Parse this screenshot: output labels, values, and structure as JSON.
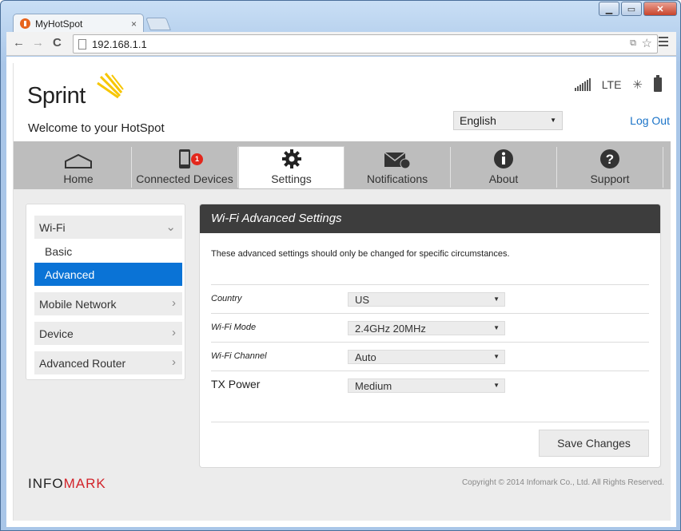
{
  "browser": {
    "tab_title": "MyHotSpot",
    "tab_close": "×",
    "url": "192.168.1.1",
    "back": "←",
    "forward": "→",
    "reload": "C",
    "star": "☆",
    "win_min": "▁",
    "win_max": "▭",
    "win_close": "✕"
  },
  "header": {
    "logo_text": "Sprint",
    "welcome": "Welcome to your HotSpot",
    "network": "LTE",
    "language": "English",
    "logout": "Log Out"
  },
  "tabs": [
    {
      "label": "Home",
      "icon": "home-icon"
    },
    {
      "label": "Connected Devices",
      "icon": "phone-icon",
      "badge": "1"
    },
    {
      "label": "Settings",
      "icon": "gear-icon"
    },
    {
      "label": "Notifications",
      "icon": "envelope-icon"
    },
    {
      "label": "About",
      "icon": "info-icon"
    },
    {
      "label": "Support",
      "icon": "help-icon"
    }
  ],
  "sidebar": {
    "wifi": "Wi-Fi",
    "basic": "Basic",
    "advanced": "Advanced",
    "mobile": "Mobile Network",
    "device": "Device",
    "router": "Advanced Router"
  },
  "panel": {
    "title": "Wi-Fi Advanced Settings",
    "description": "These advanced settings should only be changed for specific circumstances.",
    "rows": [
      {
        "label": "Country",
        "value": "US"
      },
      {
        "label": "Wi-Fi Mode",
        "value": "2.4GHz 20MHz"
      },
      {
        "label": "Wi-Fi Channel",
        "value": "Auto"
      },
      {
        "label": "TX Power",
        "value": "Medium"
      }
    ],
    "save": "Save Changes"
  },
  "footer": {
    "brand_a": "INFO",
    "brand_b": "MARK",
    "copyright": "Copyright © 2014 Infomark Co., Ltd. All Rights Reserved."
  },
  "colors": {
    "accent": "#0a73d6",
    "panel_header": "#3d3d3d",
    "badge": "#e3271c",
    "brand_red": "#d2232a"
  }
}
